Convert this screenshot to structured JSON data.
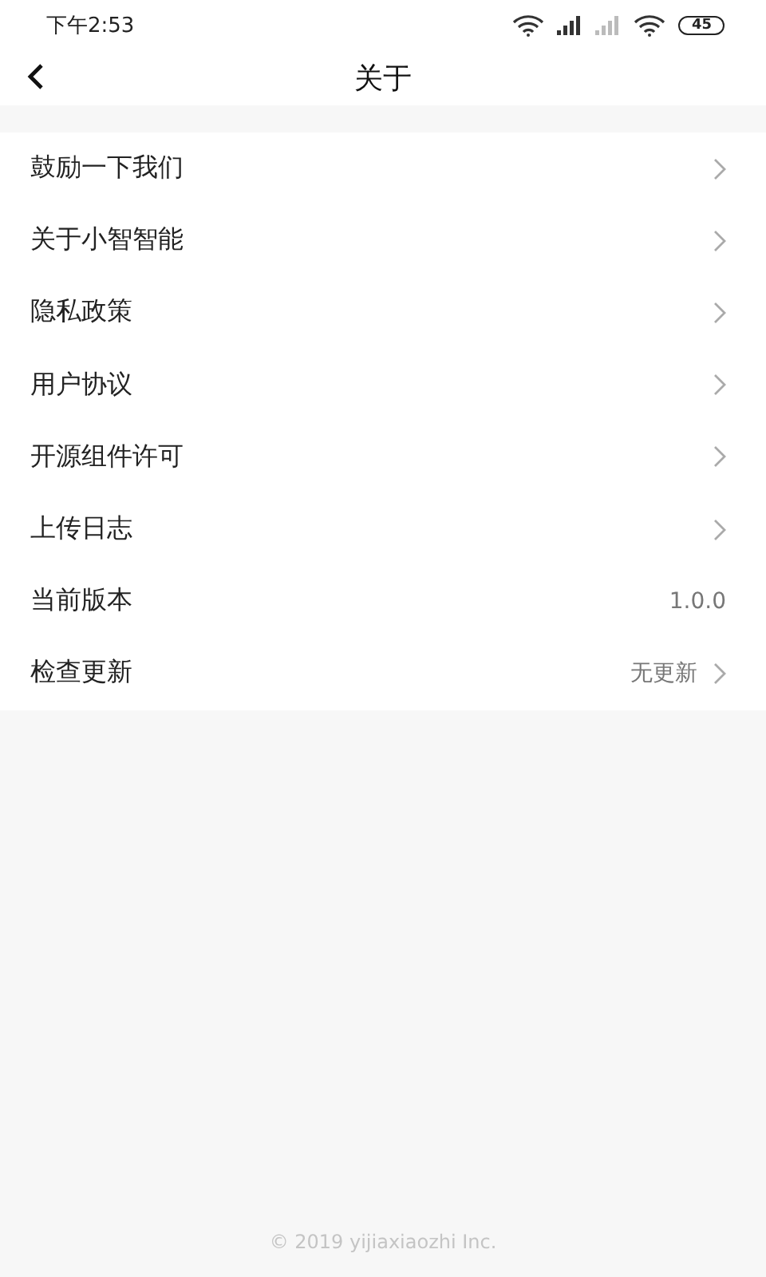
{
  "status_bar": {
    "time": "下午2:53",
    "battery": "45"
  },
  "header": {
    "title": "关于"
  },
  "items": [
    {
      "label": "鼓励一下我们",
      "kind": "link"
    },
    {
      "label": "关于小智智能",
      "kind": "link"
    },
    {
      "label": "隐私政策",
      "kind": "link"
    },
    {
      "label": "用户协议",
      "kind": "link"
    },
    {
      "label": "开源组件许可",
      "kind": "link"
    },
    {
      "label": "上传日志",
      "kind": "link"
    },
    {
      "label": "当前版本",
      "kind": "info",
      "value": "1.0.0"
    },
    {
      "label": "检查更新",
      "kind": "link",
      "value": "无更新"
    }
  ],
  "footer": "© 2019 yijiaxiaozhi Inc."
}
